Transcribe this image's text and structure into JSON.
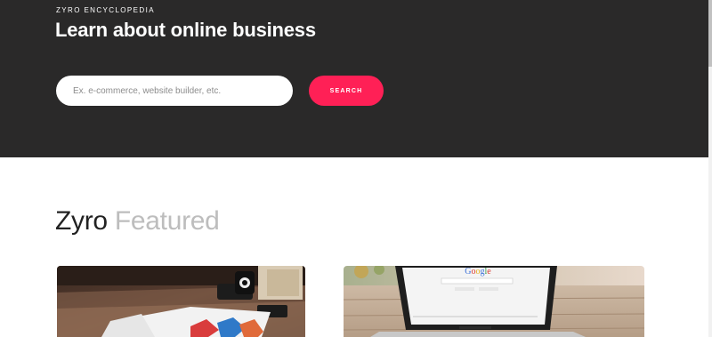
{
  "hero": {
    "eyebrow": "ZYRO ENCYCLOPEDIA",
    "title": "Learn about online business",
    "search_placeholder": "Ex. e-commerce, website builder, etc.",
    "search_button": "SEARCH"
  },
  "featured": {
    "title_main": "Zyro",
    "title_accent": "Featured"
  },
  "cards": [
    {
      "image": "t-shirt-on-desk-photo"
    },
    {
      "image": "laptop-google-search-photo",
      "image_text": "Google"
    }
  ],
  "colors": {
    "hero_bg": "#2a2929",
    "accent": "#ff2056",
    "accent_text_muted": "#bdbdbd"
  }
}
